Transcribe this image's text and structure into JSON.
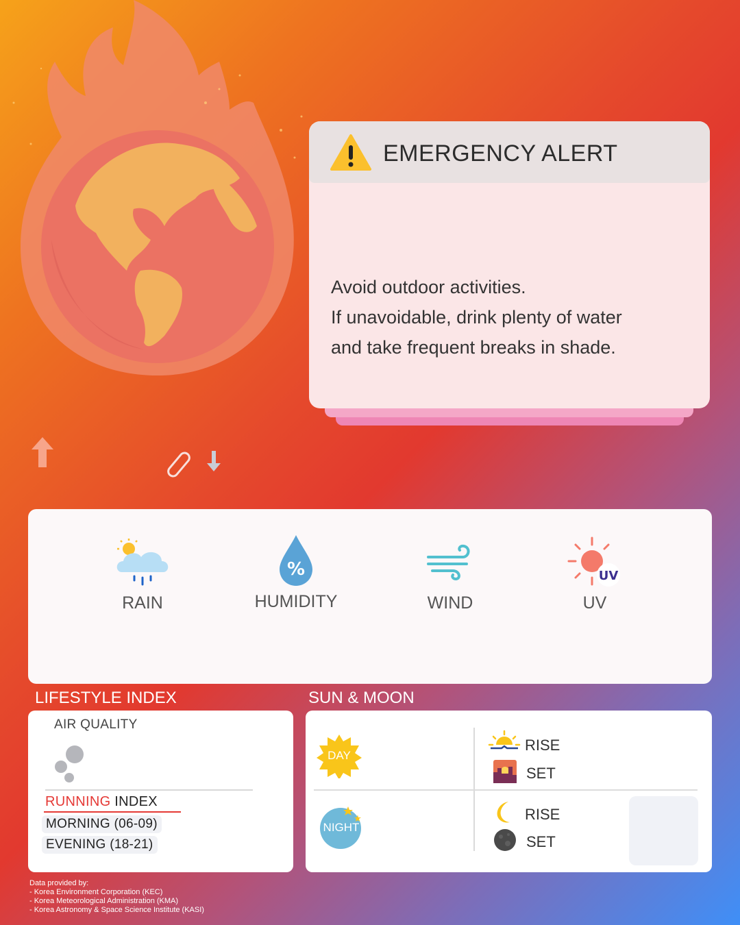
{
  "alert": {
    "title": "EMERGENCY ALERT",
    "icon": "warning-icon",
    "lines": [
      "Avoid outdoor activities.",
      "If unavoidable, drink plenty of water",
      "and take frequent breaks in shade."
    ]
  },
  "weather": {
    "items": [
      {
        "label": "RAIN",
        "icon": "rain-cloud-icon"
      },
      {
        "label": "HUMIDITY",
        "icon": "humidity-drop-icon"
      },
      {
        "label": "WIND",
        "icon": "wind-icon"
      },
      {
        "label": "UV",
        "icon": "uv-sun-icon"
      }
    ]
  },
  "lifestyle": {
    "title": "LIFESTYLE INDEX",
    "air_quality": "AIR QUALITY",
    "running_word": "RUNNING",
    "index_word": " INDEX",
    "morning": "MORNING (06-09)",
    "evening": "EVENING  (18-21)"
  },
  "sunmoon": {
    "title": "SUN & MOON",
    "day_badge": "DAY",
    "night_badge": "NIGHT",
    "sunrise": "RISE",
    "sunset": "SET",
    "moonrise": "RISE",
    "moonset": "SET"
  },
  "credits": {
    "heading": "Data provided by:",
    "sources": [
      "- Korea Environment Corporation (KEC)",
      "- Korea Meteorological Administration (KMA)",
      "- Korea Astronomy & Space Science Institute (KASI)"
    ]
  },
  "colors": {
    "accent_red": "#e53935",
    "alert_bg": "#fbe6e7",
    "day_badge": "#f9c51a",
    "night_badge": "#6fb9d9"
  }
}
